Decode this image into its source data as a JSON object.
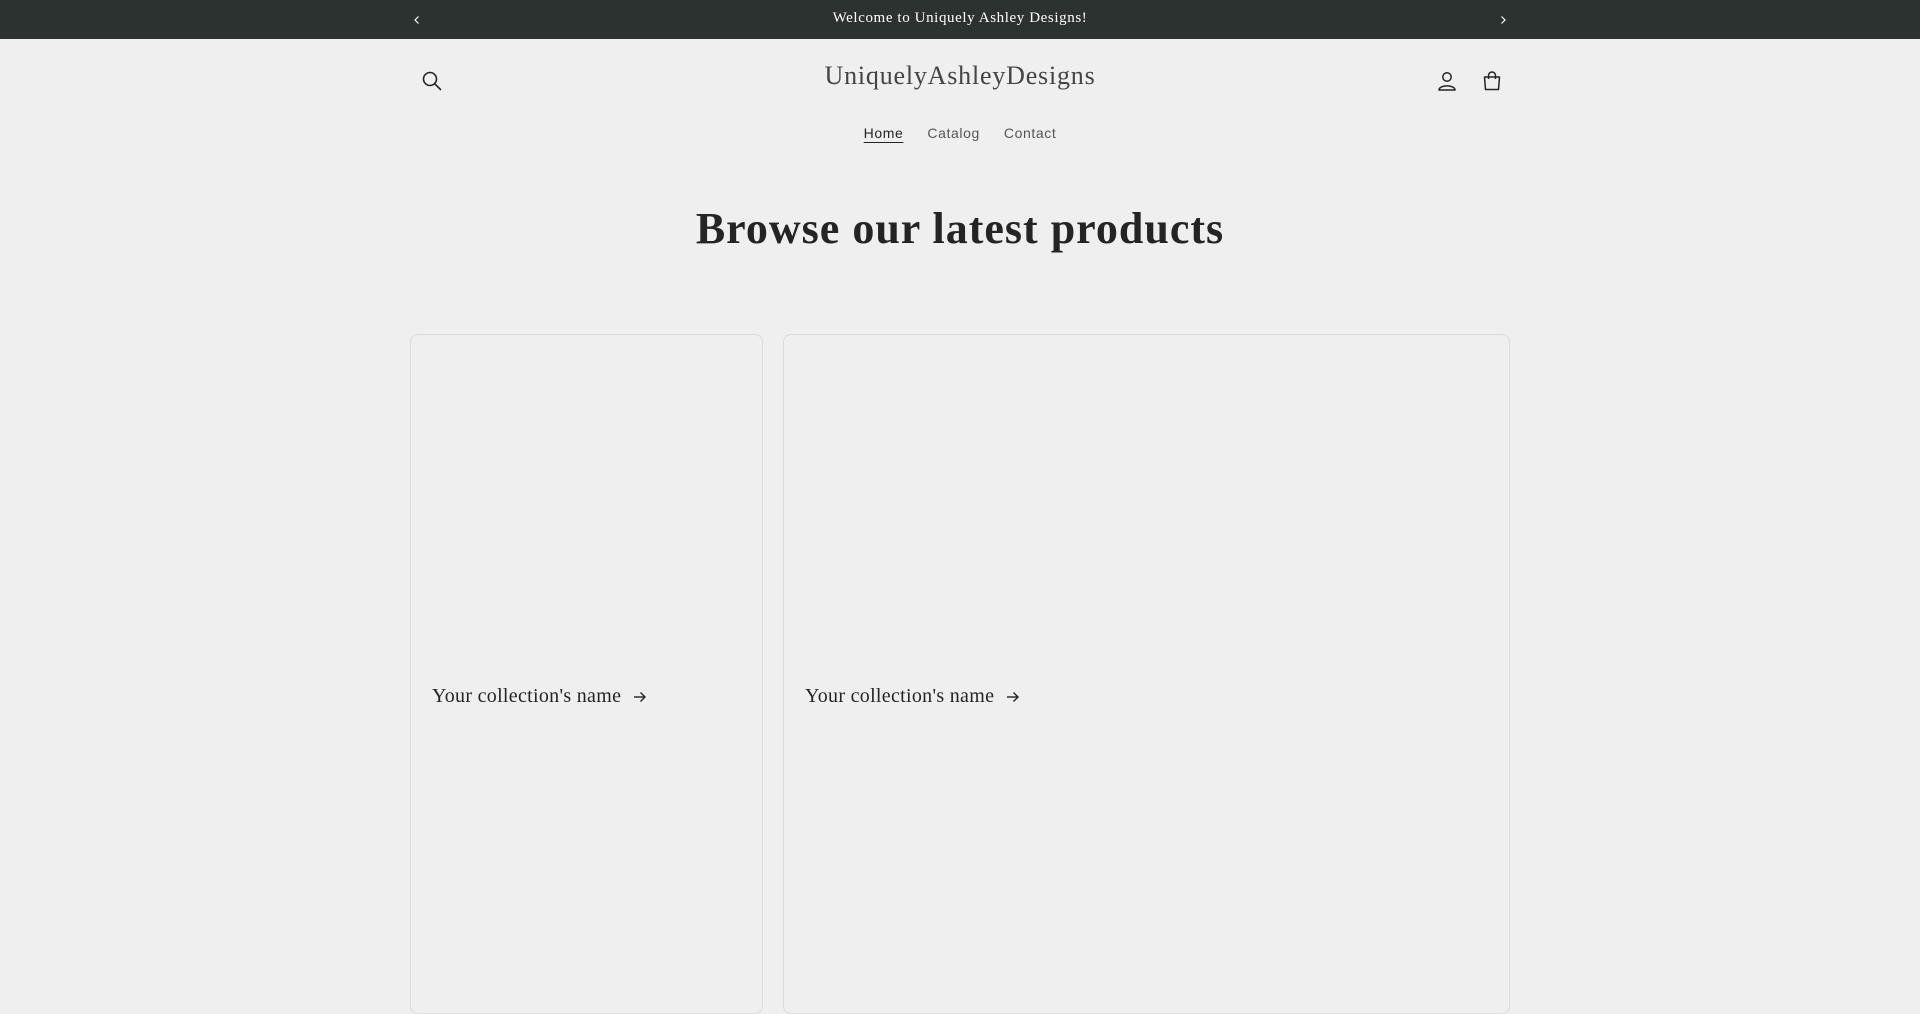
{
  "announcement": {
    "message": "Welcome to Uniquely Ashley Designs!",
    "prev_icon": "chevron-left-icon",
    "next_icon": "chevron-right-icon",
    "background": "#2b3230",
    "text_color": "#ffffff"
  },
  "header": {
    "logo": "UniquelyAshleyDesigns",
    "search_icon": "search-icon",
    "account_icon": "account-icon",
    "cart_icon": "cart-icon"
  },
  "nav": {
    "items": [
      {
        "label": "Home",
        "active": true
      },
      {
        "label": "Catalog",
        "active": false
      },
      {
        "label": "Contact",
        "active": false
      }
    ]
  },
  "main": {
    "heading": "Browse our latest products",
    "collections": [
      {
        "name": "Your collection's name",
        "icon": "arrow-right-icon"
      },
      {
        "name": "Your collection's name",
        "icon": "arrow-right-icon"
      }
    ]
  },
  "colors": {
    "page_background": "#f0eff0",
    "text": "#242424",
    "card_border": "#dcdbdc"
  }
}
